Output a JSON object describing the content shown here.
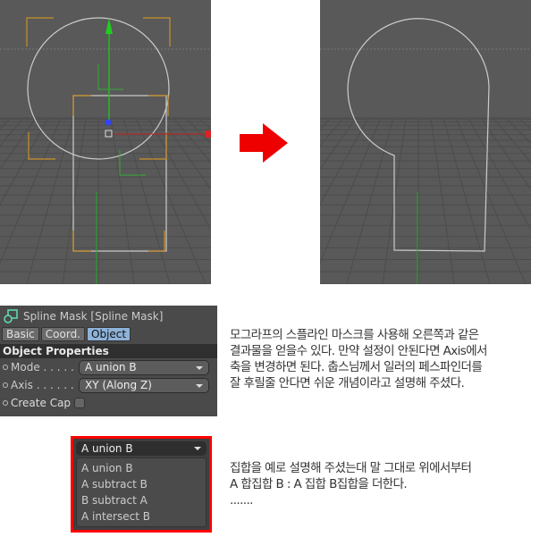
{
  "panel": {
    "title": "Spline Mask [Spline Mask]",
    "tabs": [
      "Basic",
      "Coord.",
      "Object"
    ],
    "active_tab": "Object",
    "section": "Object Properties",
    "mode_label": "Mode . . . . .",
    "mode_value": "A union B",
    "axis_label": "Axis . . . . . .",
    "axis_value": "XY (Along Z)",
    "cap_label": "Create Cap",
    "cap_checked": false
  },
  "description": {
    "lines": [
      "모그라프의 스플라인 마스크를 사용해 오른쪽과 같은",
      "결과물을 얻을수 있다. 만약 설정이 안된다면 Axis에서",
      "축을 변경하면 된다. 춥스님께서 일러의 페스파인더를",
      "잘 후릴줄 안다면 쉬운 개념이라고 설명해 주셨다."
    ]
  },
  "dropdown": {
    "current": "A union B",
    "options": [
      "A union B",
      "A subtract B",
      "B subtract A",
      "A intersect B"
    ],
    "highlight_color": "#ff0000"
  },
  "explanation": {
    "lines": [
      "집합을 예로 설명해 주셨는대 말 그대로 위에서부터",
      "A 합집합 B : A 집합 B집합을 더한다.",
      "......."
    ]
  },
  "colors": {
    "viewport_bg": "#595959",
    "arrow": "#ee0000",
    "y_axis": "#22bb22",
    "x_axis": "#cc2222",
    "z_axis": "#3344ff",
    "bbox": "#c8902a"
  }
}
